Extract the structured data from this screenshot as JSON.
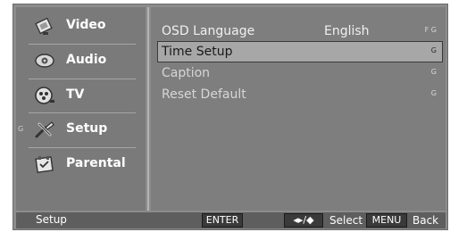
{
  "sidebar": {
    "items": [
      {
        "label": "Video",
        "icon": "video-icon"
      },
      {
        "label": "Audio",
        "icon": "audio-icon"
      },
      {
        "label": "TV",
        "icon": "tv-icon"
      },
      {
        "label": "Setup",
        "icon": "setup-icon",
        "marker": "G"
      },
      {
        "label": "Parental",
        "icon": "parental-icon"
      }
    ]
  },
  "menu": {
    "rows": [
      {
        "label": "OSD Language",
        "value": "English",
        "note": "F G"
      },
      {
        "label": "Time Setup",
        "value": "",
        "note": "G"
      },
      {
        "label": "Caption",
        "value": "",
        "note": "G"
      },
      {
        "label": "Reset Default",
        "value": "",
        "note": "G"
      }
    ],
    "selected_index": 1
  },
  "footer": {
    "title": "Setup",
    "enter_label": "ENTER",
    "arrows_label": "◂▸/◆",
    "select_label": "Select",
    "menu_label": "MENU",
    "back_label": "Back"
  },
  "colors": {
    "panel": "#8c8c8c",
    "selected": "#a7a7a7",
    "footer": "#5e5e5e",
    "button": "#3a3a3a"
  }
}
